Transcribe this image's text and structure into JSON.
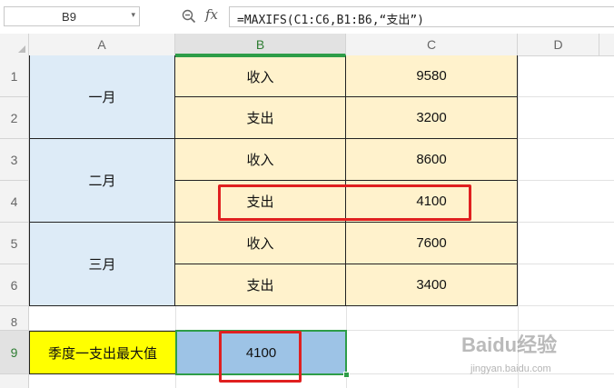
{
  "formula_bar": {
    "name_box": "B9",
    "fx_label": "fx",
    "formula": "=MAXIFS(C1:C6,B1:B6,“支出”)"
  },
  "columns": [
    "A",
    "B",
    "C",
    "D"
  ],
  "rows": [
    "1",
    "2",
    "3",
    "4",
    "5",
    "6",
    "8",
    "9"
  ],
  "cells": {
    "A1": "一月",
    "A3": "二月",
    "A5": "三月",
    "B1": "收入",
    "C1": "9580",
    "B2": "支出",
    "C2": "3200",
    "B3": "收入",
    "C3": "8600",
    "B4": "支出",
    "C4": "4100",
    "B5": "收入",
    "C5": "7600",
    "B6": "支出",
    "C6": "3400",
    "A9": "季度一支出最大值",
    "B9": "4100"
  },
  "colors": {
    "month_fill": "#ddebf7",
    "data_fill": "#fff2cc",
    "label_fill": "#ffff00",
    "result_fill": "#9dc3e6",
    "selection": "#2e9d48",
    "highlight": "#e02020"
  },
  "watermark": {
    "logo": "Baidu经验",
    "url": "jingyan.baidu.com"
  }
}
